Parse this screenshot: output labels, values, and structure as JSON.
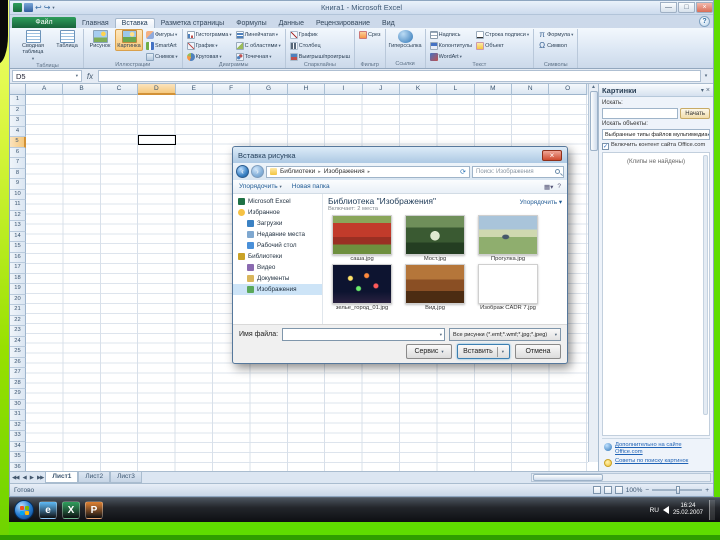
{
  "window": {
    "title": "Книга1 - Microsoft Excel"
  },
  "ribbon": {
    "tabs": [
      {
        "id": "file",
        "label": "Файл",
        "file": true
      },
      {
        "id": "home",
        "label": "Главная"
      },
      {
        "id": "insert",
        "label": "Вставка",
        "active": true
      },
      {
        "id": "page-layout",
        "label": "Разметка страницы"
      },
      {
        "id": "formulas",
        "label": "Формулы"
      },
      {
        "id": "data",
        "label": "Данные"
      },
      {
        "id": "review",
        "label": "Рецензирование"
      },
      {
        "id": "view",
        "label": "Вид"
      }
    ],
    "groups": [
      {
        "id": "tables",
        "name": "Таблицы",
        "big": [
          {
            "id": "pivot-table",
            "label": "Сводная таблица",
            "caret": true
          },
          {
            "id": "table",
            "label": "Таблица"
          }
        ]
      },
      {
        "id": "illustrations",
        "name": "Иллюстрации",
        "big": [
          {
            "id": "picture",
            "label": "Рисунок"
          },
          {
            "id": "clip-art",
            "label": "Картинка",
            "hl": true
          }
        ],
        "small": [
          {
            "id": "shapes",
            "label": "Фигуры",
            "caret": true
          },
          {
            "id": "smartart",
            "label": "SmartArt"
          },
          {
            "id": "screenshot",
            "label": "Снимок",
            "caret": true
          }
        ]
      },
      {
        "id": "charts",
        "name": "Диаграммы",
        "small": [
          {
            "id": "column-chart",
            "label": "Гистограмма",
            "caret": true
          },
          {
            "id": "line-chart",
            "label": "График",
            "caret": true
          },
          {
            "id": "pie-chart",
            "label": "Круговая",
            "caret": true
          },
          {
            "id": "bar-chart",
            "label": "Линейчатая",
            "caret": true
          },
          {
            "id": "area-chart",
            "label": "С областями",
            "caret": true
          },
          {
            "id": "scatter-chart",
            "label": "Точечная",
            "caret": true
          }
        ]
      },
      {
        "id": "sparklines",
        "name": "Спарклайны",
        "small": [
          {
            "id": "spark-line",
            "label": "График"
          },
          {
            "id": "spark-column",
            "label": "Столбец"
          },
          {
            "id": "spark-winloss",
            "label": "Выигрыш/проигрыш"
          }
        ]
      },
      {
        "id": "filter",
        "name": "Фильтр",
        "small": [
          {
            "id": "slicer",
            "label": "Срез"
          }
        ]
      },
      {
        "id": "links",
        "name": "Ссылки",
        "big": [
          {
            "id": "hyperlink",
            "label": "Гиперссылка"
          }
        ]
      },
      {
        "id": "text",
        "name": "Текст",
        "small": [
          {
            "id": "text-box",
            "label": "Надпись"
          },
          {
            "id": "header-footer",
            "label": "Колонтитулы"
          },
          {
            "id": "wordart",
            "label": "WordArt",
            "caret": true
          },
          {
            "id": "signature-line",
            "label": "Строка подписи",
            "caret": true
          },
          {
            "id": "object",
            "label": "Объект"
          }
        ]
      },
      {
        "id": "symbols",
        "name": "Символы",
        "small": [
          {
            "id": "equation",
            "label": "Формула",
            "caret": true,
            "glyph": "π"
          },
          {
            "id": "symbol",
            "label": "Символ",
            "glyph": "Ω"
          }
        ]
      }
    ]
  },
  "formula_bar": {
    "name_box": "D5",
    "fx": "fx"
  },
  "sheet": {
    "columns": [
      "A",
      "B",
      "C",
      "D",
      "E",
      "F",
      "G",
      "H",
      "I",
      "J",
      "K",
      "L",
      "M",
      "N",
      "O"
    ],
    "row_count": 38,
    "selected_column": "D",
    "selected_row": 5,
    "tabs": [
      {
        "label": "Лист1",
        "active": true
      },
      {
        "label": "Лист2"
      },
      {
        "label": "Лист3"
      }
    ],
    "status": "Готово",
    "zoom": "100%"
  },
  "dialog": {
    "title": "Вставка рисунка",
    "breadcrumb": [
      "Библиотеки",
      "Изображения"
    ],
    "search_placeholder": "Поиск: Изображения",
    "toolbar": {
      "organize": "Упорядочить",
      "new_folder": "Новая папка"
    },
    "library": {
      "title": "Библиотека \"Изображения\"",
      "subtitle": "Включает: 2 места",
      "arrange": "Упорядочить"
    },
    "nav": [
      {
        "id": "microsoft-excel",
        "label": "Microsoft Excel",
        "icon": "excel"
      },
      {
        "id": "favorites",
        "label": "Избранное",
        "icon": "star"
      },
      {
        "id": "downloads",
        "label": "Загрузки",
        "icon": "downloads",
        "indent": true
      },
      {
        "id": "recent-places",
        "label": "Недавние места",
        "icon": "recent",
        "indent": true
      },
      {
        "id": "desktop",
        "label": "Рабочий стол",
        "icon": "desktop",
        "indent": true
      },
      {
        "id": "libraries",
        "label": "Библиотеки",
        "icon": "libraries"
      },
      {
        "id": "video",
        "label": "Видео",
        "icon": "video",
        "indent": true
      },
      {
        "id": "documents",
        "label": "Документы",
        "icon": "docs",
        "indent": true
      },
      {
        "id": "pictures",
        "label": "Изображения",
        "icon": "pictures",
        "indent": true,
        "selected": true
      }
    ],
    "files": [
      {
        "name": "саша.jpg",
        "art": "poppies"
      },
      {
        "name": "Мост.jpg",
        "art": "bridge"
      },
      {
        "name": "Прогулка.jpg",
        "art": "monet"
      },
      {
        "name": "зелье_город_01.jpg",
        "art": "fireworks"
      },
      {
        "name": "Вид.jpg",
        "art": "city"
      },
      {
        "name": "Изображ CADR 7.jpg",
        "art": "white"
      }
    ],
    "file_name_label": "Имя файла:",
    "file_type": "Все рисунки (*.emf;*.wmf;*.jpg;*.jpeg)",
    "buttons": {
      "tools": "Сервис",
      "insert": "Вставить",
      "cancel": "Отмена"
    }
  },
  "task_pane": {
    "title": "Картинки",
    "search_label": "Искать:",
    "go_button": "Начать",
    "browse_label": "Искать объекты:",
    "media_type": "Выбранные типы файлов мультимедиа",
    "include_office": "Включить контент сайта Office.com",
    "empty_text": "(Клипы не найдены)",
    "link_more": "Дополнительно на сайте Office.com",
    "link_tips": "Советы по поиску картинок"
  },
  "taskbar": {
    "icons": [
      {
        "id": "internet-explorer",
        "letter": "e",
        "color": "#5db8f5"
      },
      {
        "id": "excel",
        "letter": "X",
        "color": "#2e9e5b"
      },
      {
        "id": "powerpoint",
        "letter": "P",
        "color": "#e08030"
      }
    ],
    "tray": {
      "lang": "RU",
      "time": "16:24",
      "date": "25.02.2007"
    }
  }
}
